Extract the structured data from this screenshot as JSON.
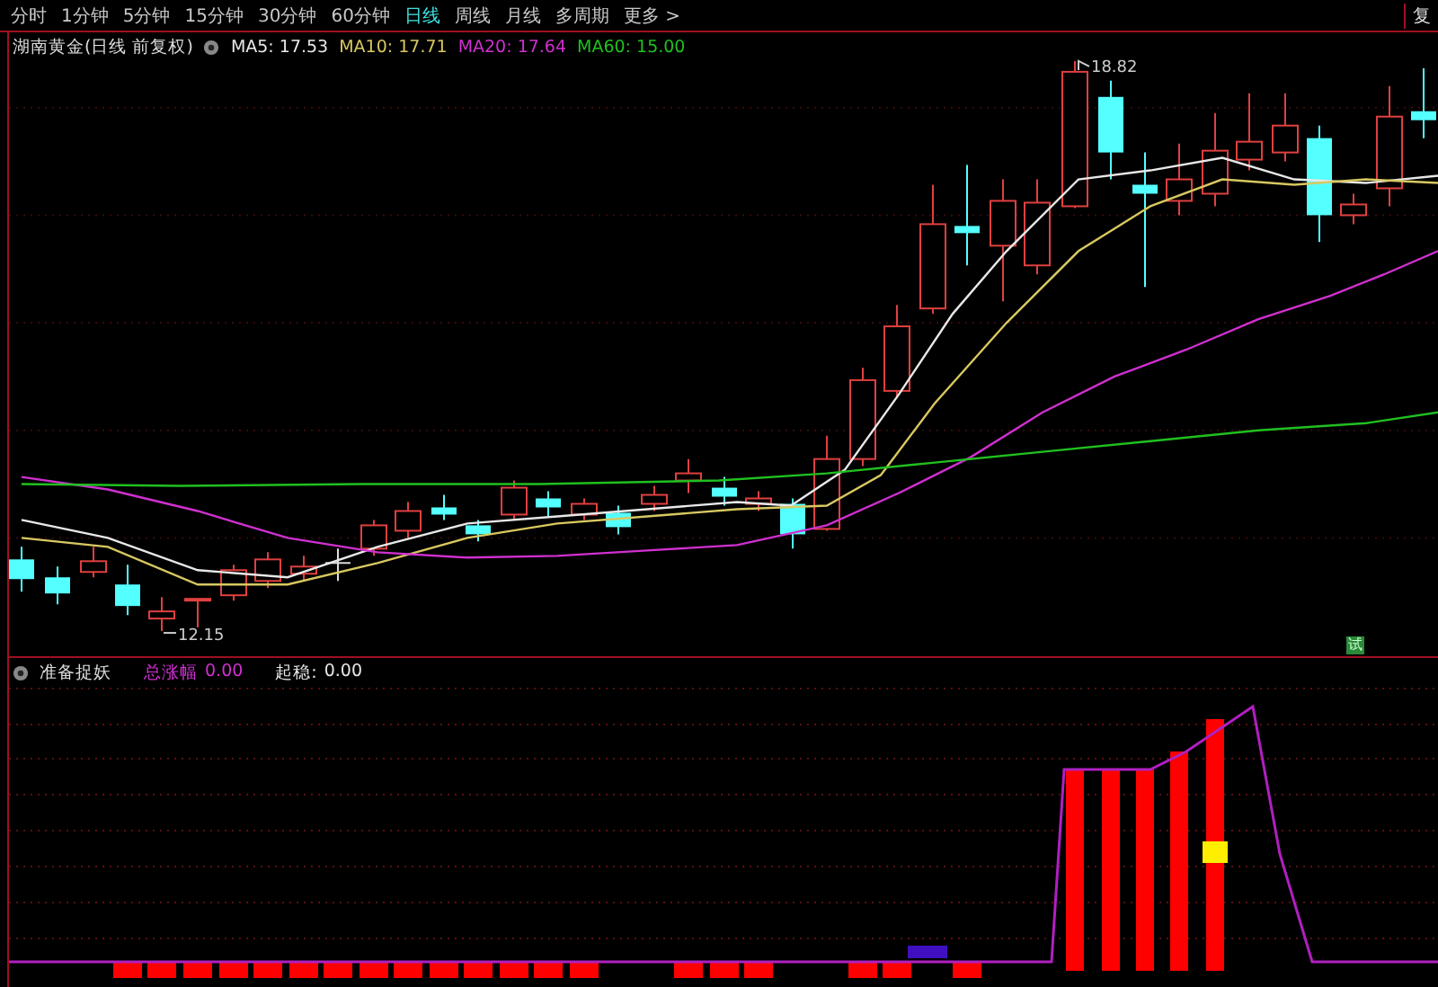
{
  "toolbar": {
    "tabs": [
      {
        "label": "分时",
        "selected": false
      },
      {
        "label": "1分钟",
        "selected": false
      },
      {
        "label": "5分钟",
        "selected": false
      },
      {
        "label": "15分钟",
        "selected": false
      },
      {
        "label": "30分钟",
        "selected": false
      },
      {
        "label": "60分钟",
        "selected": false
      },
      {
        "label": "日线",
        "selected": true
      },
      {
        "label": "周线",
        "selected": false
      },
      {
        "label": "月线",
        "selected": false
      },
      {
        "label": "多周期",
        "selected": false
      },
      {
        "label": "更多 >",
        "selected": false
      }
    ],
    "right_button": "复"
  },
  "main_chart": {
    "title": "湖南黄金(日线 前复权)",
    "moving_averages": [
      {
        "label": "MA5: 17.53",
        "color": "#e8e8e8"
      },
      {
        "label": "MA10: 17.71",
        "color": "#d8c860"
      },
      {
        "label": "MA20: 17.64",
        "color": "#d030d0"
      },
      {
        "label": "MA60: 15.00",
        "color": "#20c020"
      }
    ],
    "high_label": "18.82",
    "low_label": "12.15",
    "badge": "试"
  },
  "indicator": {
    "title": "准备捉妖",
    "readings": [
      {
        "label": "总涨幅",
        "value": "0.00",
        "color": "#d030d0"
      },
      {
        "label": "起稳:",
        "value": "0.00",
        "color": "#e8e8e8"
      }
    ]
  }
}
